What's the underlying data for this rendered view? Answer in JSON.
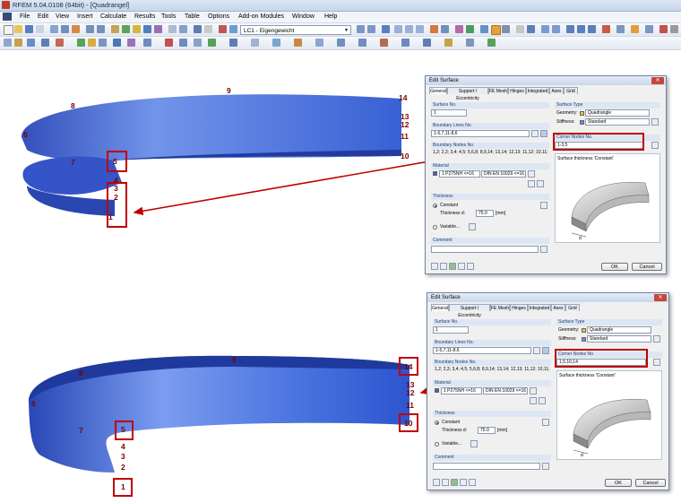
{
  "window": {
    "title": "RFEM 5.04.0108 (64bit) - [Quadrangel]"
  },
  "menu": [
    "File",
    "Edit",
    "View",
    "Insert",
    "Calculate",
    "Results",
    "Tools",
    "Table",
    "Options",
    "Add-on Modules",
    "Window",
    "Help"
  ],
  "toolbar": {
    "load_case": "LC1 - Eigengewicht"
  },
  "top_model": {
    "nodes": [
      "1",
      "2",
      "3",
      "4",
      "5",
      "6",
      "7",
      "8",
      "9",
      "10",
      "11",
      "12",
      "13",
      "14"
    ]
  },
  "bottom_model": {
    "nodes": [
      "1",
      "2",
      "3",
      "4",
      "5",
      "6",
      "7",
      "8",
      "9",
      "10",
      "11",
      "12",
      "13",
      "14"
    ]
  },
  "colors": {
    "surface": "#3a62d6",
    "highlight": "#c00000",
    "node_text": "#7a0000"
  },
  "dialog_top": {
    "title": "Edit Surface",
    "tabs": [
      "General",
      "Support / Eccentricity",
      "FE Mesh",
      "Hinges",
      "Integrated",
      "Axes",
      "Grid"
    ],
    "surface_no_label": "Surface No.",
    "surface_no": "1",
    "boundary_lines_label": "Boundary Lines No.",
    "boundary_lines": "1-5,7,11-8,6",
    "boundary_nodes_label": "Boundary Nodes No.",
    "boundary_nodes": "1,2; 2,3; 3,4; 4,5; 5,6,8; 8,9,14; 13,14; 12,13; 11,12; 10,11; 1,7,1",
    "material_label": "Material",
    "material": "1  P275NH <=16",
    "material_norm": "DIN EN 10029  <=16",
    "thickness_label": "Thickness",
    "constant": "Constant",
    "thickness_d": "Thickness d:",
    "thickness_value": "75.0",
    "thickness_unit": "[mm]",
    "variable": "Variable...",
    "comment_label": "Comment",
    "surface_type_label": "Surface Type",
    "geometry_label": "Geometry:",
    "geometry": "Quadrangle",
    "stiffness_label": "Stiffness:",
    "stiffness": "Standard",
    "corner_nodes_label": "Corner Nodes No.",
    "corner_nodes": "1-3,5",
    "thickness_preview": "Surface thickness 'Constant'",
    "preview_d": "d",
    "ok": "OK",
    "cancel": "Cancel"
  },
  "dialog_bottom": {
    "title": "Edit Surface",
    "tabs": [
      "General",
      "Support / Eccentricity",
      "FE Mesh",
      "Hinges",
      "Integrated",
      "Axes",
      "Grid"
    ],
    "surface_no_label": "Surface No.",
    "surface_no": "1",
    "boundary_lines_label": "Boundary Lines No.",
    "boundary_lines": "1-5,7,11-8,6",
    "boundary_nodes_label": "Boundary Nodes No.",
    "boundary_nodes": "1,2; 2,3; 3,4; 4,5; 5,6,8; 8,9,14; 13,14; 12,13; 11,12; 10,11; 1,7,1",
    "material_label": "Material",
    "material": "1  P275NH <=16",
    "material_norm": "DIN EN 10029  <=16",
    "thickness_label": "Thickness",
    "constant": "Constant",
    "thickness_d": "Thickness d:",
    "thickness_value": "75.0",
    "thickness_unit": "[mm]",
    "variable": "Variable...",
    "comment_label": "Comment",
    "surface_type_label": "Surface Type",
    "geometry_label": "Geometry:",
    "geometry": "Quadrangle",
    "stiffness_label": "Stiffness:",
    "stiffness": "Standard",
    "corner_nodes_label": "Corner Nodes No.",
    "corner_nodes": "1,5,10,14",
    "thickness_preview": "Surface thickness 'Constant'",
    "preview_d": "d",
    "ok": "OK",
    "cancel": "Cancel"
  }
}
